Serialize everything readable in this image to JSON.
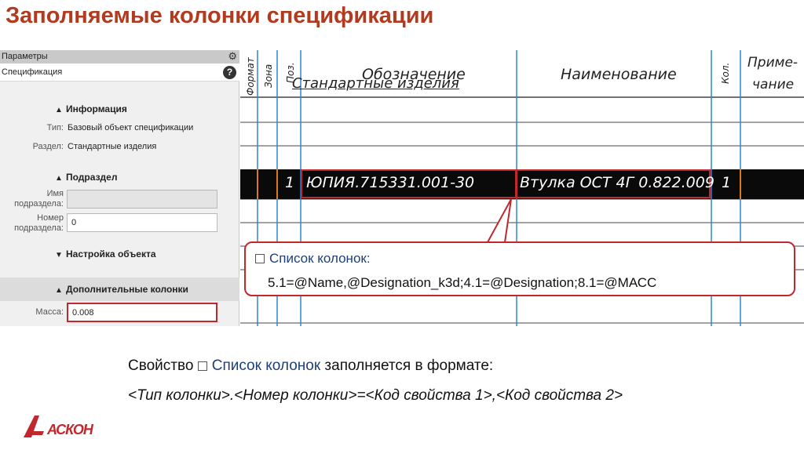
{
  "slide": {
    "title": "Заполняемые колонки спецификации"
  },
  "panel": {
    "header": "Параметры",
    "subheader": "Спецификация",
    "gear_icon": "gear-icon",
    "help_icon": "help-icon",
    "sections": {
      "info": "Информация",
      "subsection": "Подраздел",
      "object_settings": "Настройка объекта",
      "extra_columns": "Дополнительные колонки"
    },
    "info": {
      "type_label": "Тип:",
      "type_value": "Базовый объект спецификации",
      "section_label": "Раздел:",
      "section_value": "Стандартные изделия"
    },
    "subsection": {
      "name_label_1": "Имя",
      "name_label_2": "подраздела:",
      "name_value": "",
      "number_label_1": "Номер",
      "number_label_2": "подраздела:",
      "number_value": "0"
    },
    "mass": {
      "label": "Масса:",
      "value": "0.008"
    }
  },
  "spec_table": {
    "columns": {
      "format": "Формат",
      "zone": "Зона",
      "pos": "Поз.",
      "designation": "Обозначение",
      "name": "Наименование",
      "qty": "Кол.",
      "note_1": "Приме-",
      "note_2": "чание"
    },
    "section_title": "Стандартные изделия",
    "selected_row": {
      "pos": "1",
      "designation": "ЮПИЯ.715331.001-30",
      "name": "Втулка ОСТ 4Г 0.822.009",
      "qty": "1"
    },
    "colors": {
      "column_line": "#2f86d6",
      "highlight": "#c0282d",
      "selected_row_bg": "#0a0a0a"
    }
  },
  "callout": {
    "title": "Список колонок:",
    "value": "5.1=@Name,@Designation_k3d;4.1=@Designation;8.1=@МАСС"
  },
  "description": {
    "line1_prefix": "Свойство ",
    "line1_highlight": "Список колонок",
    "line1_suffix": " заполняется в формате:",
    "line2": "<Тип колонки>.<Номер колонки>=<Код свойства 1>,<Код свойства 2>"
  },
  "logo": {
    "text": "АСКОН",
    "color": "#c0282d"
  }
}
